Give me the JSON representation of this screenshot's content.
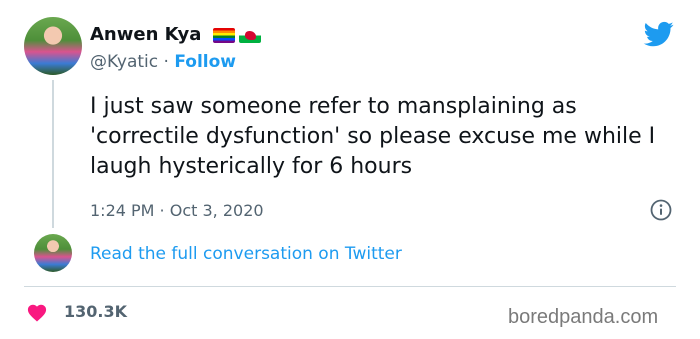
{
  "author": {
    "display_name": "Anwen Kya",
    "handle": "@Kyatic",
    "separator": "·",
    "follow_label": "Follow",
    "flags": [
      "rainbow-flag-icon",
      "wales-flag-icon"
    ]
  },
  "tweet": {
    "text": "I just saw someone refer to mansplaining as 'correctile dysfunction' so please excuse me while I laugh hysterically for 6 hours",
    "timestamp": "1:24 PM · Oct 3, 2020"
  },
  "conversation": {
    "link_label": "Read the full conversation on Twitter"
  },
  "engagement": {
    "likes": "130.3K",
    "like_icon": "heart-icon"
  },
  "watermark": "boredpanda.com",
  "colors": {
    "accent": "#1d9bf0",
    "heart": "#f91880",
    "text_primary": "#0f1419",
    "text_secondary": "#536471",
    "divider": "#cfd9de"
  }
}
